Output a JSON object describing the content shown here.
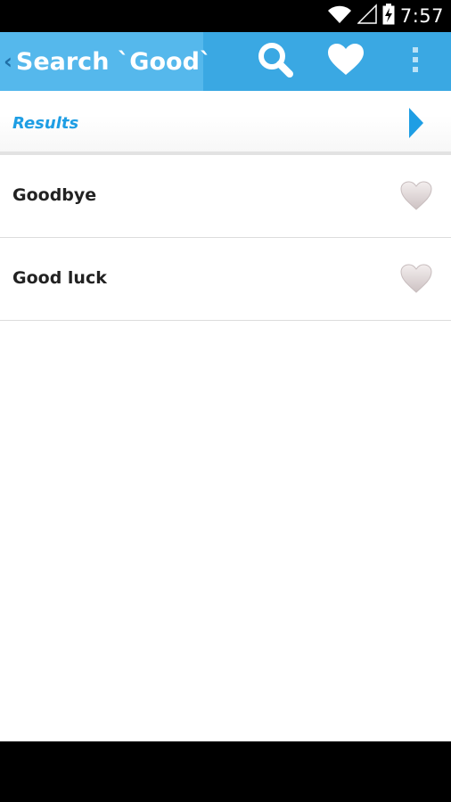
{
  "status_bar": {
    "time": "7:57",
    "icons": [
      "wifi-icon",
      "signal-icon",
      "battery-charging-icon"
    ]
  },
  "action_bar": {
    "title": "Search `Good`",
    "actions": [
      "search-icon",
      "heart-icon",
      "overflow-menu-icon"
    ],
    "colors": {
      "bar": "#3aa8e3",
      "title_area": "#55b8ec"
    }
  },
  "results": {
    "label": "Results",
    "accent": "#1e9ee4"
  },
  "list": {
    "items": [
      {
        "word": "Goodbye",
        "favorite": false
      },
      {
        "word": "Good luck",
        "favorite": false
      }
    ]
  }
}
